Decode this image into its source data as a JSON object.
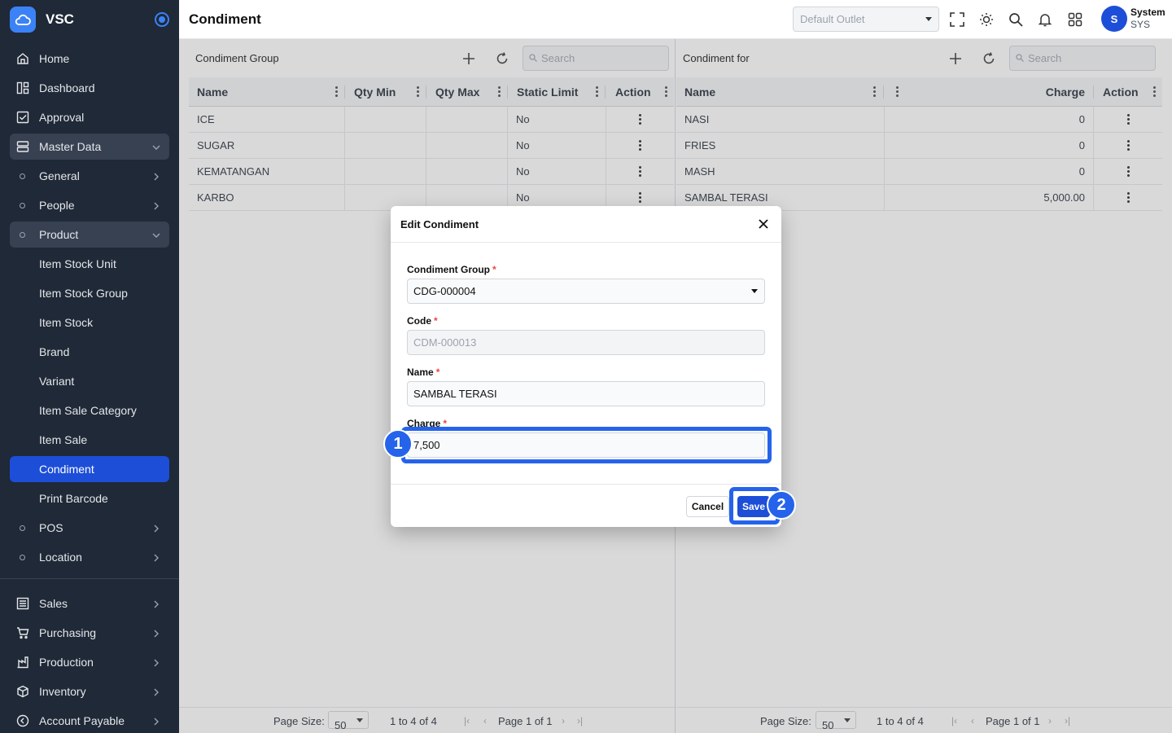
{
  "app": {
    "name": "VSC"
  },
  "header": {
    "title": "Condiment",
    "outlet_placeholder": "Default Outlet",
    "user_name": "System",
    "user_role": "SYS",
    "user_initial": "S"
  },
  "sidebar": {
    "items": [
      {
        "label": "Home",
        "icon": "home-icon"
      },
      {
        "label": "Dashboard",
        "icon": "dashboard-icon"
      },
      {
        "label": "Approval",
        "icon": "approval-icon"
      },
      {
        "label": "Master Data",
        "icon": "database-icon"
      },
      {
        "label": "General"
      },
      {
        "label": "People"
      },
      {
        "label": "Product"
      },
      {
        "label": "Item Stock Unit"
      },
      {
        "label": "Item Stock Group"
      },
      {
        "label": "Item Stock"
      },
      {
        "label": "Brand"
      },
      {
        "label": "Variant"
      },
      {
        "label": "Item Sale Category"
      },
      {
        "label": "Item Sale"
      },
      {
        "label": "Condiment"
      },
      {
        "label": "Print Barcode"
      },
      {
        "label": "POS"
      },
      {
        "label": "Location"
      },
      {
        "label": "Sales",
        "icon": "sales-icon"
      },
      {
        "label": "Purchasing",
        "icon": "cart-icon"
      },
      {
        "label": "Production",
        "icon": "factory-icon"
      },
      {
        "label": "Inventory",
        "icon": "box-icon"
      },
      {
        "label": "Account Payable",
        "icon": "payable-icon"
      }
    ]
  },
  "left_panel": {
    "title": "Condiment Group",
    "search_placeholder": "Search",
    "columns": [
      "Name",
      "Qty Min",
      "Qty Max",
      "Static Limit",
      "Action"
    ],
    "rows": [
      {
        "name": "ICE",
        "qty_min": "",
        "qty_max": "",
        "static_limit": "No"
      },
      {
        "name": "SUGAR",
        "qty_min": "",
        "qty_max": "",
        "static_limit": "No"
      },
      {
        "name": "KEMATANGAN",
        "qty_min": "",
        "qty_max": "",
        "static_limit": "No"
      },
      {
        "name": "KARBO",
        "qty_min": "",
        "qty_max": "",
        "static_limit": "No"
      }
    ],
    "pager": {
      "size_label": "Page Size:",
      "size": "50",
      "range": "1 to 4 of 4",
      "page": "Page 1 of 1"
    }
  },
  "right_panel": {
    "title": "Condiment for",
    "search_placeholder": "Search",
    "columns": [
      "Name",
      "Charge",
      "Action"
    ],
    "rows": [
      {
        "name": "NASI",
        "charge": "0"
      },
      {
        "name": "FRIES",
        "charge": "0"
      },
      {
        "name": "MASH",
        "charge": "0"
      },
      {
        "name": "SAMBAL TERASI",
        "charge": "5,000.00"
      }
    ],
    "pager": {
      "size_label": "Page Size:",
      "size": "50",
      "range": "1 to 4 of 4",
      "page": "Page 1 of 1"
    }
  },
  "modal": {
    "title": "Edit Condiment",
    "fields": {
      "group": {
        "label": "Condiment Group",
        "value": "CDG-000004"
      },
      "code": {
        "label": "Code",
        "value": "CDM-000013"
      },
      "name": {
        "label": "Name",
        "value": "SAMBAL TERASI"
      },
      "charge": {
        "label": "Charge",
        "value": "7,500"
      }
    },
    "required_mark": "*",
    "cancel_label": "Cancel",
    "save_label": "Save"
  },
  "annotations": {
    "step1": "1",
    "step2": "2"
  },
  "colors": {
    "accent": "#2563eb",
    "sidebar_bg": "#1f2937",
    "active": "#1d4ed8"
  }
}
